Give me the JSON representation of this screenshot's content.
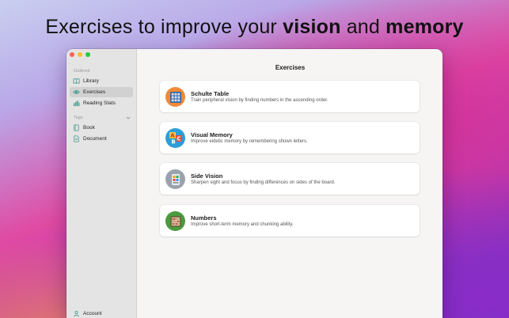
{
  "headline": {
    "part1": "Exercises to improve your ",
    "bold1": "vision",
    "part2": " and ",
    "bold2": "memory"
  },
  "sidebar": {
    "outlined_label": "Outlined",
    "items": [
      {
        "label": "Library",
        "icon": "book-open-icon"
      },
      {
        "label": "Exercises",
        "icon": "eye-icon",
        "active": true
      },
      {
        "label": "Reading Stats",
        "icon": "bar-chart-icon"
      }
    ],
    "tags_label": "Tags",
    "tags": [
      {
        "label": "Book",
        "icon": "book-icon"
      },
      {
        "label": "Document",
        "icon": "document-icon"
      }
    ],
    "account_label": "Account"
  },
  "main": {
    "title": "Exercises",
    "cards": [
      {
        "title": "Schulte Table",
        "desc": "Train peripheral vision by finding numbers in the ascending order.",
        "icon": "grid-table-icon",
        "color": "#f08a3a"
      },
      {
        "title": "Visual Memory",
        "desc": "Improve eidetic memory by remembering shown letters.",
        "icon": "abc-blocks-icon",
        "color": "#2a9fd8"
      },
      {
        "title": "Side Vision",
        "desc": "Sharpen sight and focus by finding differences on sides of the board.",
        "icon": "side-vision-icon",
        "color": "#9aa3ad"
      },
      {
        "title": "Numbers",
        "desc": "Improve short-term memory and chunking ability.",
        "icon": "abacus-icon",
        "color": "#4a9a3e"
      }
    ]
  },
  "colors": {
    "accent": "#e04aa3",
    "window_bg": "#f6f5f4",
    "sidebar_bg": "#e5e4e4"
  }
}
